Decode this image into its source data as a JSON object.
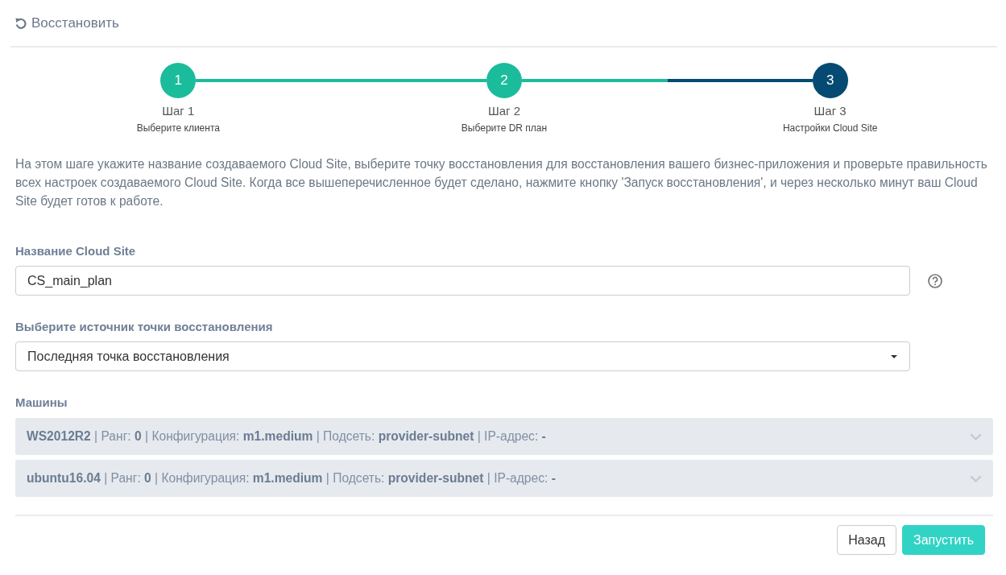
{
  "header": {
    "title": "Восстановить"
  },
  "steps": [
    {
      "number": "1",
      "title": "Шаг 1",
      "subtitle": "Выберите клиента",
      "selected": false
    },
    {
      "number": "2",
      "title": "Шаг 2",
      "subtitle": "Выберите DR план",
      "selected": false
    },
    {
      "number": "3",
      "title": "Шаг 3",
      "subtitle": "Настройки Cloud Site",
      "selected": true
    }
  ],
  "description": "На этом шаге укажите название создаваемого Cloud Site, выберите точку восстановления для восстановления вашего бизнес-приложения и проверьте правильность всех настроек создаваемого Cloud Site. Когда все вышеперечисленное будет сделано, нажмите кнопку 'Запуск восстановления', и через несколько минут ваш Cloud Site будет готов к работе.",
  "cloud_site_name": {
    "label": "Название Cloud Site",
    "value": "CS_main_plan"
  },
  "restore_point_source": {
    "label": "Выберите источник точки восстановления",
    "value": "Последняя точка восстановления"
  },
  "machines": {
    "label": "Машины",
    "items": [
      {
        "summary": "**WS2012R2** | Ранг: **0** | Конфигурация: **m1.medium** | Подсеть: **provider-subnet** | IP-адрес: **-**",
        "expanded": false
      },
      {
        "summary": "**ubuntu16.04** | Ранг: **0** | Конфигурация: **m1.medium** | Подсеть: **provider-subnet** | IP-адрес: **-**",
        "expanded": false
      }
    ]
  },
  "buttons": [
    {
      "label": "Назад",
      "kind": "secondary"
    },
    {
      "label": "Запустить",
      "kind": "primary"
    }
  ]
}
